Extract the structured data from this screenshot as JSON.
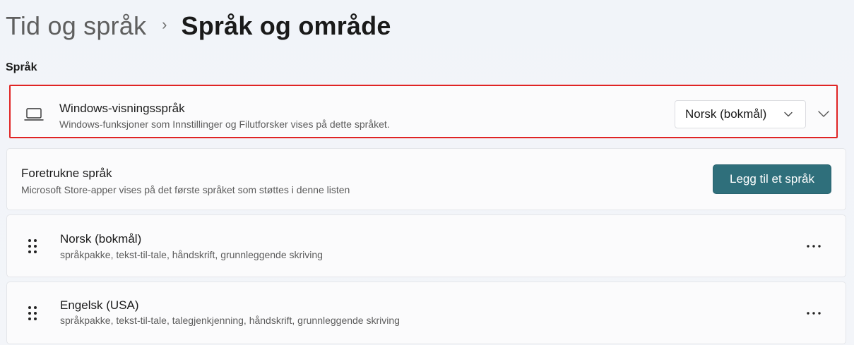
{
  "breadcrumb": {
    "parent": "Tid og språk",
    "separator": "›",
    "current": "Språk og område"
  },
  "section": {
    "title": "Språk"
  },
  "display_language": {
    "title": "Windows-visningsspråk",
    "subtitle": "Windows-funksjoner som Innstillinger og Filutforsker vises på dette språket.",
    "selected": "Norsk (bokmål)",
    "icon": "laptop-icon"
  },
  "preferred_languages": {
    "title": "Foretrukne språk",
    "subtitle": "Microsoft Store-apper vises på det første språket som støttes i denne listen",
    "add_button": "Legg til et språk"
  },
  "languages": [
    {
      "name": "Norsk (bokmål)",
      "features": "språkpakke, tekst-til-tale, håndskrift, grunnleggende skriving"
    },
    {
      "name": "Engelsk (USA)",
      "features": "språkpakke, tekst-til-tale, talegjenkjenning, håndskrift, grunnleggende skriving"
    }
  ],
  "colors": {
    "accent": "#2f6f7b",
    "highlight": "#e02424"
  }
}
